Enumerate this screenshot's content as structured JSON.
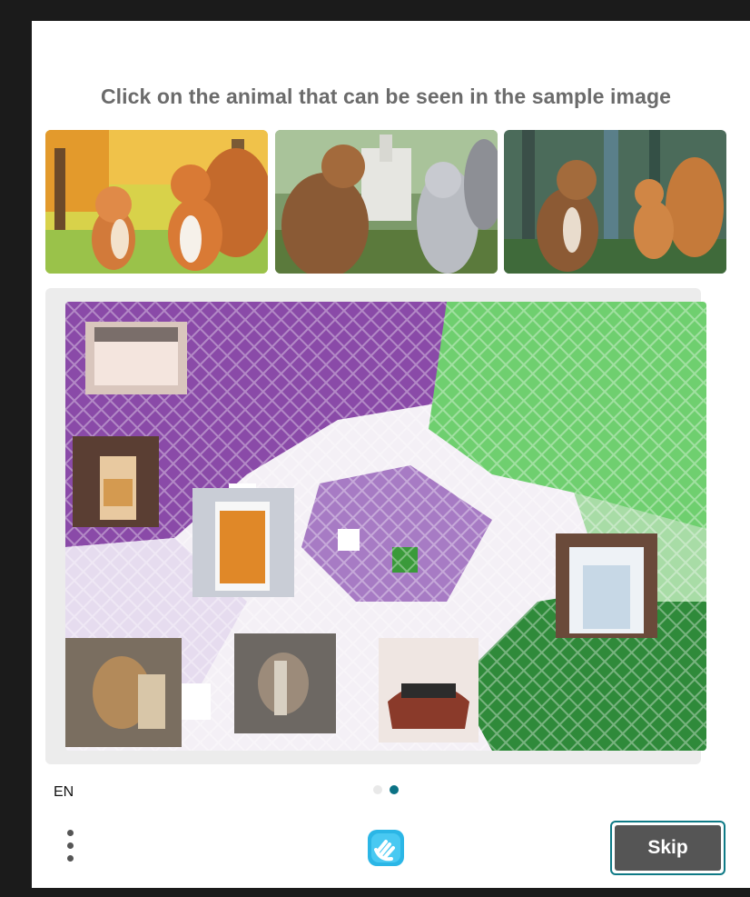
{
  "prompt": {
    "text": "Click on the animal that can be seen in the sample image"
  },
  "samples": [
    {
      "name": "cartoon cat and squirrel in park"
    },
    {
      "name": "cat and squirrel in front of building"
    },
    {
      "name": "cat and squirrel in forest"
    }
  ],
  "challenge": {
    "tiles": [
      "bucket",
      "glass",
      "cup",
      "glass",
      "animal",
      "bird",
      "object",
      "animal"
    ],
    "colors": {
      "purple": "#8a4aa8",
      "green": "#5fbf5f",
      "white": "#ffffff"
    }
  },
  "footer": {
    "language": "EN",
    "pagination": {
      "current": 2,
      "total": 2
    },
    "skip_label": "Skip",
    "menu_icon": "vertical-ellipsis",
    "logo_icon": "hand-logo"
  },
  "theme": {
    "accent": "#0b7285",
    "button_bg": "#555555"
  }
}
